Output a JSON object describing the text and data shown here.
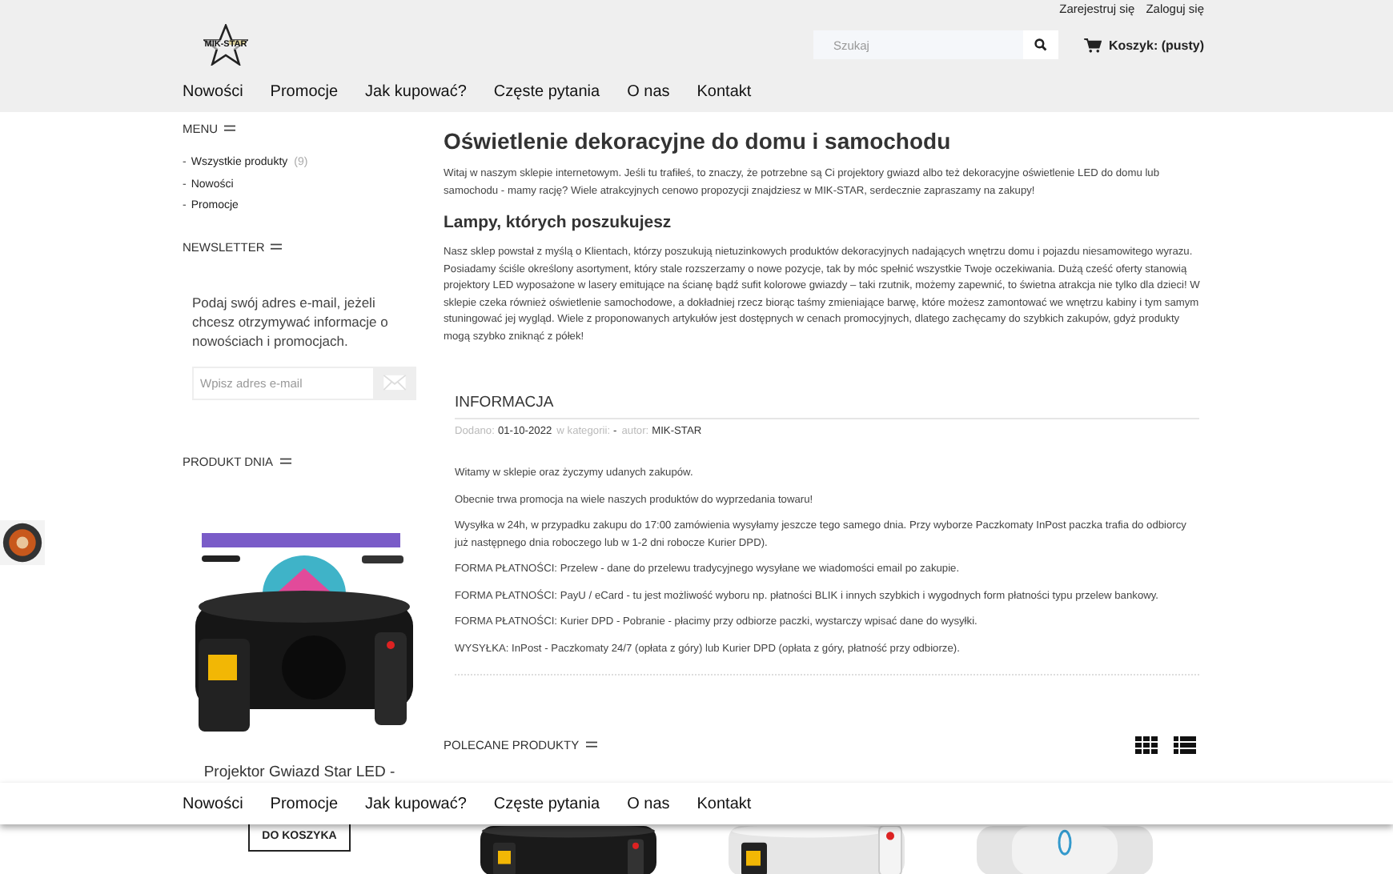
{
  "top_links": [
    "Zarejestruj się",
    "Zaloguj się"
  ],
  "logo": {
    "text": "MIK-STAR"
  },
  "search": {
    "placeholder": "Szukaj"
  },
  "cart": {
    "label": "Koszyk: (pusty)"
  },
  "nav": [
    "Nowości",
    "Promocje",
    "Jak kupować?",
    "Częste pytania",
    "O nas",
    "Kontakt"
  ],
  "sidebar": {
    "menu": {
      "title": "MENU",
      "items": [
        {
          "bullet": "-",
          "label": "Wszystkie produkty",
          "count": "(9)"
        },
        {
          "bullet": "-",
          "label": "Nowości"
        },
        {
          "bullet": "-",
          "label": "Promocje"
        }
      ]
    },
    "newsletter": {
      "title": "NEWSLETTER",
      "text": "Podaj swój adres e-mail, jeżeli chcesz otrzymywać informacje o nowościach i promocjach.",
      "placeholder": "Wpisz adres e-mail"
    },
    "product_of_day": {
      "title": "PRODUKT DNIA",
      "name": "Projektor Gwiazd Star LED -",
      "button": "DO KOSZYKA"
    }
  },
  "main": {
    "title": "Oświetlenie dekoracyjne do domu i samochodu",
    "intro": "Witaj w naszym sklepie internetowym. Jeśli tu trafiłeś, to znaczy, że potrzebne są Ci projektory gwiazd albo też dekoracyjne oświetlenie LED do domu lub samochodu - mamy rację? Wiele atrakcyjnych cenowo propozycji znajdziesz w MIK-STAR, serdecznie zapraszamy na zakupy!",
    "subtitle": "Lampy, których poszukujesz",
    "body": "Nasz sklep powstał z myślą o Klientach, którzy poszukują nietuzinkowych produktów dekoracyjnych nadających wnętrzu domu i pojazdu niesamowitego wyrazu. Posiadamy ściśle określony asortyment, który stale rozszerzamy o nowe pozycje, tak by móc spełnić wszystkie Twoje oczekiwania. Dużą cześć oferty stanowią projektory LED wyposażone w lasery emitujące na ścianę bądź sufit kolorowe gwiazdy – taki rzutnik, możemy zapewnić, to świetna atrakcja nie tylko dla dzieci! W sklepie czeka również oświetlenie samochodowe, a dokładniej rzecz biorąc taśmy zmieniające barwę, które możesz zamontować we wnętrzu kabiny i tym samym stuningować jej wygląd. Wiele z proponowanych artykułów jest dostępnych w cenach promocyjnych, dlatego zachęcamy do szybkich zakupów, gdyż produkty mogą szybko zniknąć z półek!"
  },
  "info": {
    "title": "INFORMACJA",
    "meta": [
      {
        "label": "Dodano:",
        "value": "01-10-2022"
      },
      {
        "label": "w kategorii:",
        "value": "-"
      },
      {
        "label": "autor:",
        "value": "MIK-STAR"
      }
    ],
    "paragraphs": [
      "Witamy w sklepie oraz życzymy udanych zakupów.",
      "Obecnie trwa promocja na wiele naszych produktów do wyprzedania towaru!",
      "Wysyłka w 24h, w przypadku zakupu do 17:00 zamówienia wysyłamy jeszcze tego samego dnia. Przy wyborze Paczkomaty InPost paczka trafia do odbiorcy już następnego dnia roboczego lub w 1-2 dni robocze Kurier DPD).",
      "FORMA PŁATNOŚCI: Przelew - dane do przelewu tradycyjnego wysyłane we wiadomości email po zakupie.",
      "FORMA PŁATNOŚCI: PayU / eCard - tu jest możliwość wyboru np. płatności BLIK i innych szybkich i wygodnych form płatności typu przelew bankowy.",
      "FORMA PŁATNOŚCI: Kurier DPD - Pobranie - płacimy przy odbiorze paczki, wystarczy wpisać dane do wysyłki.",
      "WYSYŁKA: InPost - Paczkomaty 24/7 (opłata z góry) lub Kurier DPD (opłata z góry, płatność przy odbiorze)."
    ]
  },
  "recommended": {
    "title": "POLECANE PRODUKTY"
  },
  "sticky_nav": [
    "Nowości",
    "Promocje",
    "Jak kupować?",
    "Częste pytania",
    "O nas",
    "Kontakt"
  ]
}
